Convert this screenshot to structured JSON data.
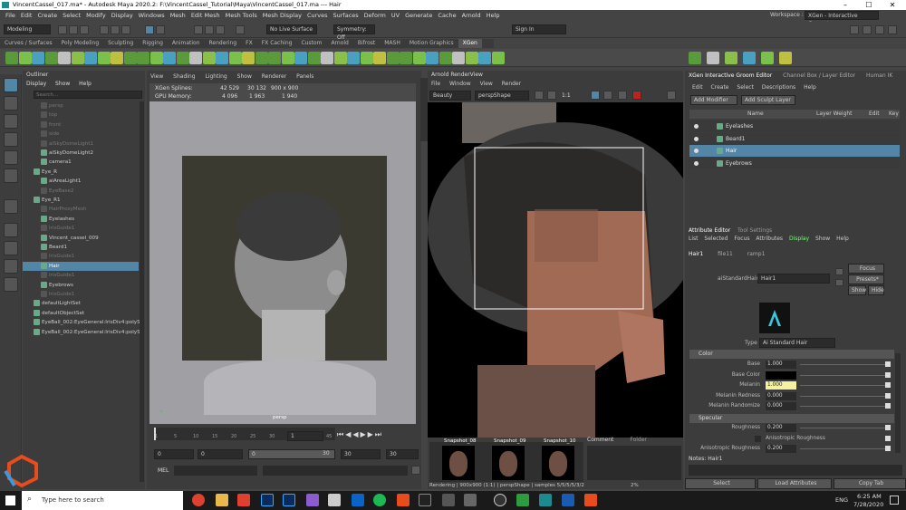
{
  "window": {
    "title": "VincentCassel_017.ma* - Autodesk Maya 2020.2: F:\\VincentCassel_Tutorial\\Maya\\VincentCassel_017.ma  ---  Hair",
    "workspace_label": "Workspace :",
    "workspace": "XGen - Interactive Groom*"
  },
  "menubar": [
    "File",
    "Edit",
    "Create",
    "Select",
    "Modify",
    "Display",
    "Windows",
    "Mesh",
    "Edit Mesh",
    "Mesh Tools",
    "Mesh Display",
    "Curves",
    "Surfaces",
    "Deform",
    "UV",
    "Generate",
    "Cache",
    "Arnold",
    "Help"
  ],
  "status": {
    "mode": "Modeling",
    "live_surface": "No Live Surface",
    "symmetry": "Symmetry: Off",
    "sign_in": "Sign In"
  },
  "shelf_tabs": [
    "Curves / Surfaces",
    "Poly Modeling",
    "Sculpting",
    "Rigging",
    "Animation",
    "Rendering",
    "FX",
    "FX Caching",
    "Custom",
    "Arnold",
    "Bifrost",
    "MASH",
    "Motion Graphics",
    "XGen"
  ],
  "shelf_active": "XGen",
  "outliner": {
    "title": "Outliner",
    "menu": [
      "Display",
      "Show",
      "Help"
    ],
    "search_placeholder": "Search...",
    "items": [
      {
        "label": "persp",
        "dim": true
      },
      {
        "label": "top",
        "dim": true
      },
      {
        "label": "front",
        "dim": true
      },
      {
        "label": "side",
        "dim": true
      },
      {
        "label": "aiSkyDomeLight1",
        "dim": true
      },
      {
        "label": "aiSkyDomeLight2",
        "dim": false
      },
      {
        "label": "camera1",
        "dim": false
      },
      {
        "label": "Eye_R",
        "dim": false
      },
      {
        "label": "aiAreaLight1",
        "dim": false
      },
      {
        "label": "EyeBase2",
        "dim": true
      },
      {
        "label": "Eye_R1",
        "dim": false
      },
      {
        "label": "HairProxyMesh",
        "dim": true
      },
      {
        "label": "Eyelashes",
        "dim": false
      },
      {
        "label": "IrisGuide1",
        "dim": true
      },
      {
        "label": "Vincent_cassel_009",
        "dim": false
      },
      {
        "label": "Beard1",
        "dim": false
      },
      {
        "label": "IrisGuide1",
        "dim": true
      },
      {
        "label": "Hair",
        "dim": false,
        "selected": true
      },
      {
        "label": "IrisGuide1",
        "dim": true
      },
      {
        "label": "Eyebrows",
        "dim": false
      },
      {
        "label": "IrisGuide1",
        "dim": true
      },
      {
        "label": "defaultLightSet",
        "dim": false
      },
      {
        "label": "defaultObjectSet",
        "dim": false
      },
      {
        "label": "EyeBall_002:EyeGeneral:IrisDiv4:polySu",
        "dim": false
      },
      {
        "label": "EyeBall_002:EyeGeneral:IrisDiv4:polySu",
        "dim": false
      }
    ]
  },
  "viewport": {
    "menu": [
      "View",
      "Shading",
      "Lighting",
      "Show",
      "Renderer",
      "Panels"
    ],
    "hud": {
      "label1": "XGen Splines:",
      "label2": "GPU Memory:",
      "v1": [
        "42 529",
        "30 132",
        "900 x 900"
      ],
      "v2": [
        "4 096",
        "1 963",
        "1 940"
      ]
    },
    "camera": "persp"
  },
  "timeline": {
    "ticks": [
      "1",
      "5",
      "10",
      "15",
      "20",
      "25",
      "30",
      "35",
      "40",
      "45"
    ],
    "current": "1",
    "start": "0",
    "range_start": "0",
    "range_field": "0",
    "range_end": "30",
    "end1": "30",
    "end2": "30",
    "mel": "MEL"
  },
  "arnold": {
    "title": "Arnold RenderView",
    "menu": [
      "File",
      "Window",
      "View",
      "Render"
    ],
    "aov": "Beauty",
    "camera": "perspShape",
    "ratio": "1:1",
    "snapshots": [
      "Snapshot_08",
      "Snapshot_09",
      "Snapshot_10"
    ],
    "tabs": [
      "Comment",
      "Folder"
    ],
    "status": "Rendering | 900x900 (1:1) | perspShape | samples 5/5/5/5/3/2",
    "zoom": "2%"
  },
  "xgen": {
    "tabs": [
      "XGen Interactive Groom Editor",
      "Channel Box / Layer Editor",
      "Human IK"
    ],
    "menu": [
      "Edit",
      "Create",
      "Select",
      "Descriptions",
      "Help"
    ],
    "add_modifier": "Add Modifier",
    "add_sculpt": "Add Sculpt Layer",
    "cols": [
      "Name",
      "Layer Weight",
      "Edit",
      "Key"
    ],
    "rows": [
      "Eyelashes",
      "Beard1",
      "Hair",
      "Eyebrows"
    ],
    "selected_row": "Hair"
  },
  "attr": {
    "tabs": [
      "Attribute Editor",
      "Tool Settings"
    ],
    "menu": [
      "List",
      "Selected",
      "Focus",
      "Attributes",
      "Display",
      "Show",
      "Help"
    ],
    "node_tabs": [
      "Hair1",
      "file11",
      "ramp1"
    ],
    "shader_label": "aiStandardHair:",
    "shader_name": "Hair1",
    "focus": "Focus",
    "presets": "Presets*",
    "show": "Show",
    "hide": "Hide",
    "type_label": "Type",
    "type_value": "Ai Standard Hair",
    "sections": {
      "color": "Color",
      "specular": "Specular"
    },
    "color_rows": [
      {
        "label": "Base",
        "value": "1.000"
      },
      {
        "label": "Base Color",
        "value": ""
      },
      {
        "label": "Melanin",
        "value": "1.000"
      },
      {
        "label": "Melanin Redness",
        "value": "0.000"
      },
      {
        "label": "Melanin Randomize",
        "value": "0.000"
      }
    ],
    "spec_rows": [
      {
        "label": "Roughness",
        "value": "0.200"
      },
      {
        "label": "Anisotropic Roughness",
        "value": ""
      },
      {
        "label": "Anisotropic Roughness",
        "value": "0.200"
      }
    ],
    "notes": "Notes: Hair1",
    "buttons": [
      "Select",
      "Load Attributes",
      "Copy Tab"
    ]
  },
  "taskbar": {
    "search": "Type here to search",
    "time": "6:25 AM",
    "date": "7/28/2020",
    "lang": "ENG"
  }
}
